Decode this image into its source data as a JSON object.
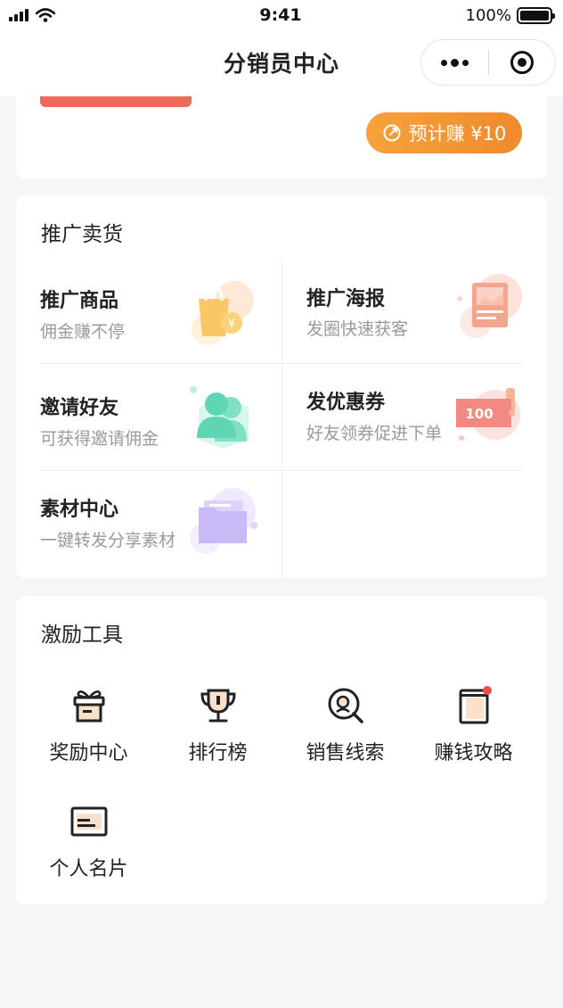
{
  "status_bar": {
    "time": "9:41",
    "battery": "100%"
  },
  "nav": {
    "title": "分销员中心"
  },
  "top_card": {
    "estimate_label": "预计赚 ¥10"
  },
  "promo": {
    "title": "推广卖货",
    "items": [
      {
        "title": "推广商品",
        "subtitle": "佣金赚不停",
        "icon": "shopping-bag-icon"
      },
      {
        "title": "推广海报",
        "subtitle": "发圈快速获客",
        "icon": "poster-icon"
      },
      {
        "title": "邀请好友",
        "subtitle": "可获得邀请佣金",
        "icon": "friends-icon"
      },
      {
        "title": "发优惠券",
        "subtitle": "好友领券促进下单",
        "icon": "coupon-icon"
      },
      {
        "title": "素材中心",
        "subtitle": "一键转发分享素材",
        "icon": "folder-icon"
      }
    ]
  },
  "tools": {
    "title": "激励工具",
    "items": [
      {
        "label": "奖励中心",
        "icon": "gift-icon"
      },
      {
        "label": "排行榜",
        "icon": "trophy-icon"
      },
      {
        "label": "销售线索",
        "icon": "leads-search-icon"
      },
      {
        "label": "赚钱攻略",
        "icon": "guide-book-icon"
      },
      {
        "label": "个人名片",
        "icon": "business-card-icon"
      }
    ]
  },
  "coupon_text": "100",
  "colors": {
    "accent_orange": "#f39433",
    "accent_red": "#ee6a5b",
    "background": "#f5f6f8"
  }
}
